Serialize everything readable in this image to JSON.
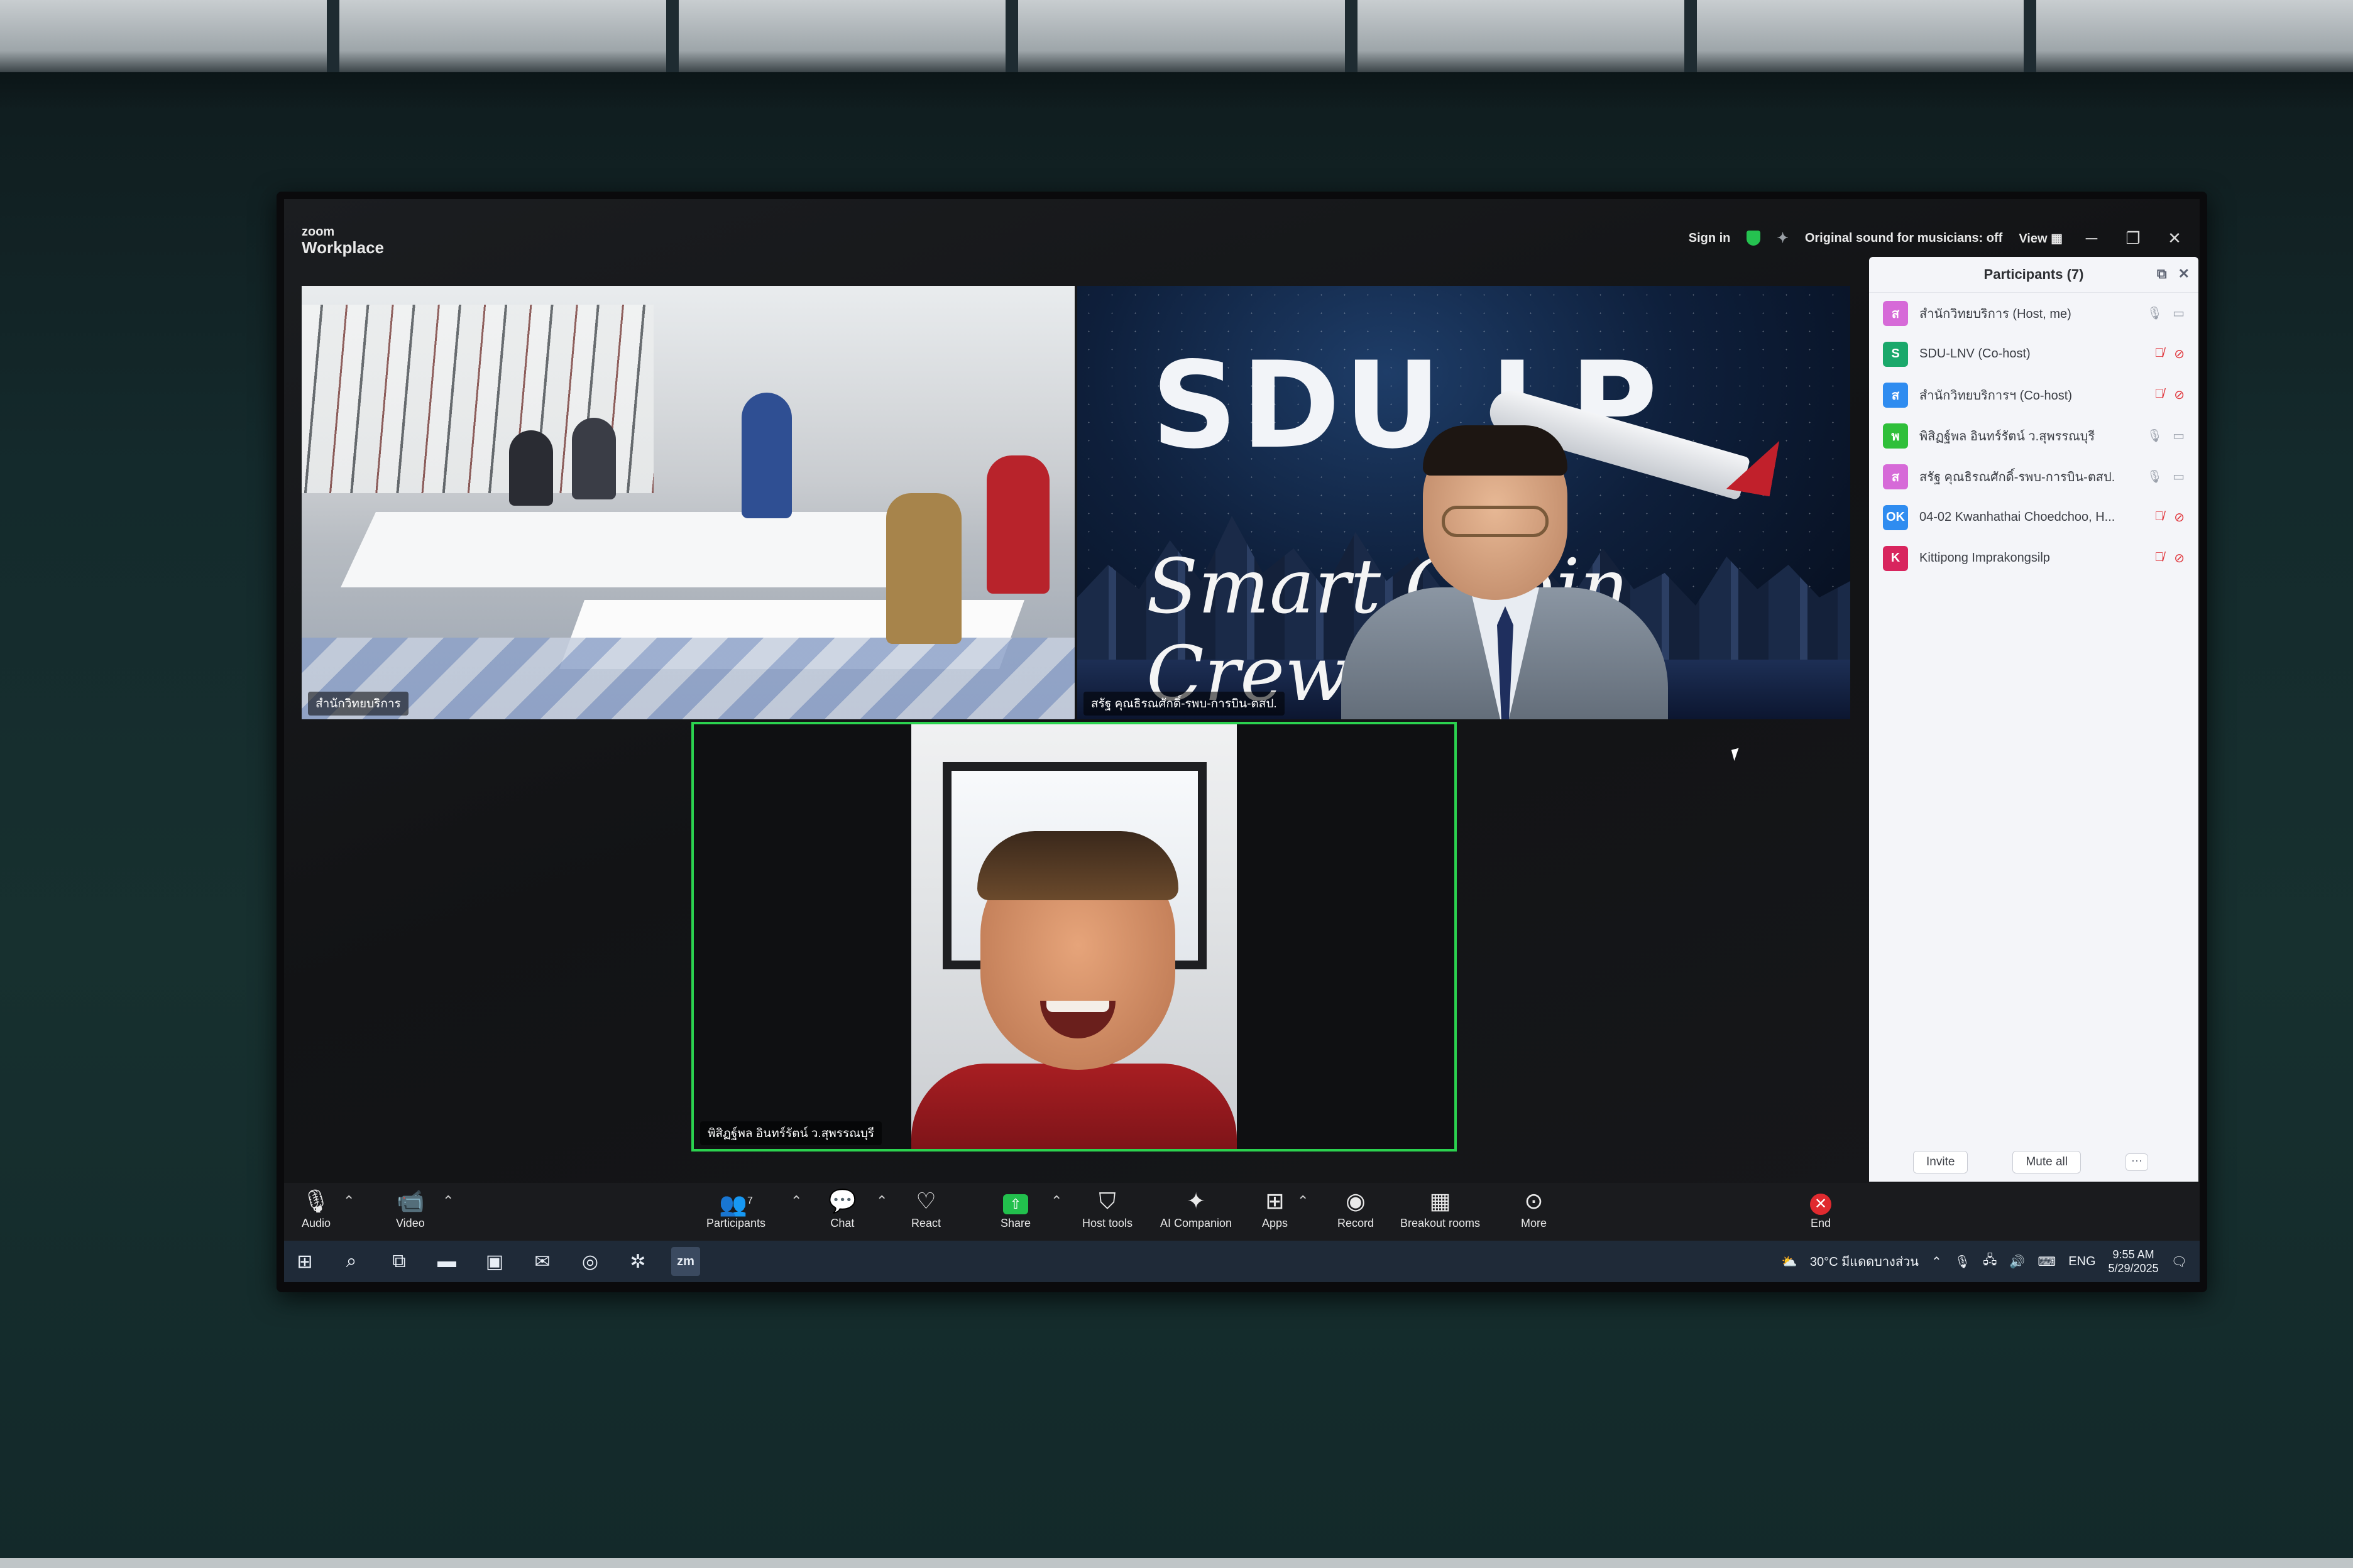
{
  "app": {
    "logo_small": "zoom",
    "logo_big": "Workplace"
  },
  "topbar": {
    "sign_in": "Sign in",
    "sound_label": "Original sound for musicians: off",
    "view_label": "View"
  },
  "videos": [
    {
      "label": "สำนักวิทยบริการ"
    },
    {
      "label": "สรัฐ คุณธิรณศักดิ์-รพบ-การบิน-ตสป.",
      "brand_text": "SDU LP",
      "script_text": "Smart Cabin Crew"
    },
    {
      "label": "พิสิฏฐ์พล อินทร์รัตน์ ว.สุพรรณบุรี"
    }
  ],
  "participants": {
    "title": "Participants (7)",
    "list": [
      {
        "initial": "ส",
        "name": "สำนักวิทยบริการ (Host, me)",
        "color": "#d66ad8",
        "muted": false
      },
      {
        "initial": "S",
        "name": "SDU-LNV (Co-host)",
        "color": "#1aa86b",
        "muted": true
      },
      {
        "initial": "ส",
        "name": "สำนักวิทยบริการฯ (Co-host)",
        "color": "#2f8cf0",
        "muted": true
      },
      {
        "initial": "พ",
        "name": "พิสิฏฐ์พล อินทร์รัตน์ ว.สุพรรณบุรี",
        "color": "#2fbf3a",
        "muted": false
      },
      {
        "initial": "ส",
        "name": "สรัฐ คุณธิรณศักดิ์-รพบ-การบิน-ตสป.",
        "color": "#d66ad8",
        "muted": false
      },
      {
        "initial": "OK",
        "name": "04-02 Kwanhathai Choedchoo, H...",
        "color": "#2f8cf0",
        "muted": true
      },
      {
        "initial": "K",
        "name": "Kittipong Imprakongsilp",
        "color": "#d8255e",
        "muted": true
      }
    ],
    "invite_label": "Invite",
    "mute_all_label": "Mute all",
    "more_label": "···"
  },
  "toolbar": {
    "audio": "Audio",
    "video": "Video",
    "participants": "Participants",
    "participants_count": "7",
    "chat": "Chat",
    "react": "React",
    "share": "Share",
    "host_tools": "Host tools",
    "ai_companion": "AI Companion",
    "apps": "Apps",
    "record": "Record",
    "breakout_rooms": "Breakout rooms",
    "more": "More",
    "end": "End"
  },
  "taskbar": {
    "weather": "30°C มีแดดบางส่วน",
    "language": "ENG",
    "time": "9:55 AM",
    "date": "5/29/2025",
    "zoom_icon_text": "zm"
  }
}
